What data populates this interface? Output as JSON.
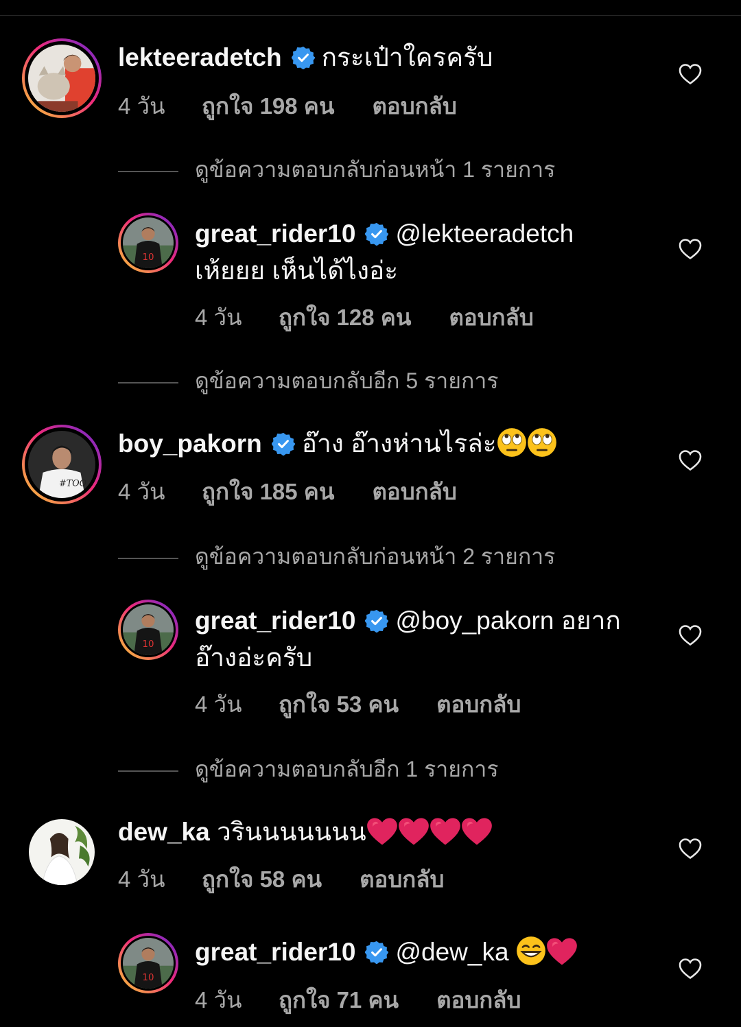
{
  "comments": [
    {
      "user": "lekteeradetch",
      "text": "กระเป๋าใครครับ",
      "time": "4 วัน",
      "likes": "ถูกใจ 198 คน",
      "reply": "ตอบกลับ"
    },
    {
      "user": "great_rider10",
      "mention": "@lekteeradetch",
      "text": "เห้ยยย เห็นได้ไงอ่ะ",
      "time": "4 วัน",
      "likes": "ถูกใจ 128 คน",
      "reply": "ตอบกลับ"
    },
    {
      "user": "boy_pakorn",
      "text": "อ๊าง อ๊างห่านไรล่ะ",
      "time": "4 วัน",
      "likes": "ถูกใจ 185 คน",
      "reply": "ตอบกลับ"
    },
    {
      "user": "great_rider10",
      "mention": "@boy_pakorn",
      "text": "อยาก อ๊างอ่ะครับ",
      "time": "4 วัน",
      "likes": "ถูกใจ 53 คน",
      "reply": "ตอบกลับ"
    },
    {
      "user": "dew_ka",
      "text": "วรินนนนนนน",
      "time": "4 วัน",
      "likes": "ถูกใจ 58 คน",
      "reply": "ตอบกลับ"
    },
    {
      "user": "great_rider10",
      "mention": "@dew_ka",
      "text": "",
      "time": "4 วัน",
      "likes": "ถูกใจ 71 คน",
      "reply": "ตอบกลับ"
    }
  ],
  "view_replies": [
    "ดูข้อความตอบกลับก่อนหน้า 1 รายการ",
    "ดูข้อความตอบกลับอีก 5 รายการ",
    "ดูข้อความตอบกลับก่อนหน้า 2 รายการ",
    "ดูข้อความตอบกลับอีก 1 รายการ"
  ],
  "colors": {
    "background": "#000000",
    "text": "#f5f5f5",
    "secondary": "#a8a8a8",
    "verified": "#3897f0",
    "heart_emoji": "#e0245e"
  },
  "icons": {
    "verified": "verified-badge-icon",
    "like": "heart-outline-icon",
    "eyeroll": "eye-roll-emoji",
    "grin": "grin-emoji",
    "heart": "red-heart-emoji"
  }
}
